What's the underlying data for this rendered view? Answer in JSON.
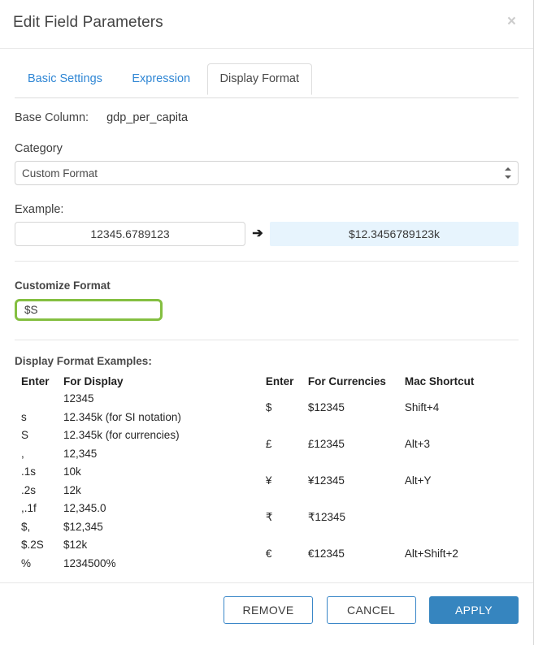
{
  "dialog": {
    "title": "Edit Field Parameters",
    "close_label": "×"
  },
  "tabs": [
    {
      "label": "Basic Settings",
      "active": false
    },
    {
      "label": "Expression",
      "active": false
    },
    {
      "label": "Display Format",
      "active": true
    }
  ],
  "base_column": {
    "label": "Base Column:",
    "value": "gdp_per_capita"
  },
  "category": {
    "label": "Category",
    "selected": "Custom Format"
  },
  "example": {
    "label": "Example:",
    "input_value": "12345.6789123",
    "arrow": "➔",
    "output_value": "$12.3456789123k"
  },
  "customize_format": {
    "label": "Customize Format",
    "value": "$S"
  },
  "display_examples": {
    "title": "Display Format Examples:",
    "left_table": {
      "headers": [
        "Enter",
        "For Display"
      ],
      "rows": [
        [
          "",
          "12345"
        ],
        [
          "s",
          "12.345k (for SI notation)"
        ],
        [
          "S",
          "12.345k (for currencies)"
        ],
        [
          ",",
          "12,345"
        ],
        [
          ".1s",
          "10k"
        ],
        [
          ".2s",
          "12k"
        ],
        [
          ",.1f",
          "12,345.0"
        ],
        [
          "$,",
          "$12,345"
        ],
        [
          "$.2S",
          "$12k"
        ],
        [
          "%",
          "1234500%"
        ]
      ]
    },
    "right_table": {
      "headers": [
        "Enter",
        "For Currencies",
        "Mac Shortcut"
      ],
      "rows": [
        [
          "$",
          "$12345",
          "Shift+4"
        ],
        [
          "£",
          "£12345",
          "Alt+3"
        ],
        [
          "¥",
          "¥12345",
          "Alt+Y"
        ],
        [
          "₹",
          "₹12345",
          ""
        ],
        [
          "€",
          "€12345",
          "Alt+Shift+2"
        ]
      ]
    }
  },
  "footer": {
    "remove_label": "REMOVE",
    "cancel_label": "CANCEL",
    "apply_label": "APPLY"
  },
  "colors": {
    "link_blue": "#2f86d4",
    "primary_blue": "#3685bf",
    "focus_green": "#84bf41",
    "output_bg": "#e7f4fd"
  }
}
